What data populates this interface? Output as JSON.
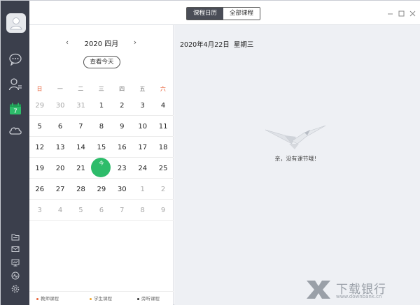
{
  "rail": {
    "icons": [
      "avatar-icon",
      "chat-icon",
      "contacts-icon",
      "calendar-icon",
      "cloud-icon",
      "folder-icon",
      "mail-icon",
      "screen-icon",
      "monitor-icon",
      "settings-icon"
    ],
    "calendar_badge": "7",
    "accent_color": "#2dbc6a"
  },
  "topbar": {
    "tabs": [
      {
        "label": "课程日历",
        "active": true
      },
      {
        "label": "全部课程",
        "active": false
      }
    ],
    "window_controls": [
      "minimize",
      "maximize",
      "close"
    ]
  },
  "calendar": {
    "month_title": "2020 四月",
    "prev_label": "‹",
    "next_label": "›",
    "today_button": "查看今天",
    "weekdays": [
      "日",
      "一",
      "二",
      "三",
      "四",
      "五",
      "六"
    ],
    "today_label": "今",
    "rows": [
      [
        {
          "d": "29",
          "o": true
        },
        {
          "d": "30",
          "o": true
        },
        {
          "d": "31",
          "o": true
        },
        {
          "d": "1"
        },
        {
          "d": "2"
        },
        {
          "d": "3"
        },
        {
          "d": "4"
        }
      ],
      [
        {
          "d": "5"
        },
        {
          "d": "6"
        },
        {
          "d": "7"
        },
        {
          "d": "8"
        },
        {
          "d": "9"
        },
        {
          "d": "10"
        },
        {
          "d": "11"
        }
      ],
      [
        {
          "d": "12"
        },
        {
          "d": "13"
        },
        {
          "d": "14"
        },
        {
          "d": "15"
        },
        {
          "d": "16"
        },
        {
          "d": "17"
        },
        {
          "d": "18"
        }
      ],
      [
        {
          "d": "19"
        },
        {
          "d": "20"
        },
        {
          "d": "21"
        },
        {
          "d": "22",
          "t": true
        },
        {
          "d": "23"
        },
        {
          "d": "24"
        },
        {
          "d": "25"
        }
      ],
      [
        {
          "d": "26"
        },
        {
          "d": "27"
        },
        {
          "d": "28"
        },
        {
          "d": "29"
        },
        {
          "d": "30"
        },
        {
          "d": "1",
          "o": true
        },
        {
          "d": "2",
          "o": true
        }
      ],
      [
        {
          "d": "3",
          "o": true
        },
        {
          "d": "4",
          "o": true
        },
        {
          "d": "5",
          "o": true
        },
        {
          "d": "6",
          "o": true
        },
        {
          "d": "7",
          "o": true
        },
        {
          "d": "8",
          "o": true
        },
        {
          "d": "9",
          "o": true
        }
      ]
    ],
    "legend": [
      {
        "label": "教师课程",
        "color": "#e8633b"
      },
      {
        "label": "学生课程",
        "color": "#f0a52a"
      },
      {
        "label": "旁听课程",
        "color": "#333333"
      }
    ]
  },
  "detail": {
    "date": "2020年4月22日",
    "weekday": "星期三",
    "empty_message": "亲，没有课节哦！"
  },
  "watermark": {
    "name": "下载银行",
    "url": "www.downbank.cn"
  }
}
